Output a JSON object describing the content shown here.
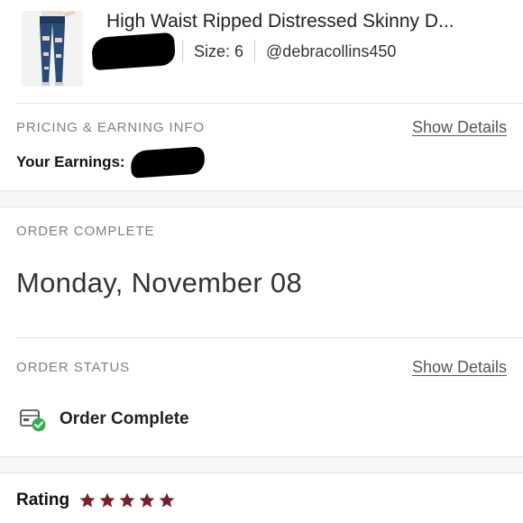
{
  "product": {
    "title": "High Waist Ripped Distressed Skinny D...",
    "size": "Size: 6",
    "seller": "@debracollins450"
  },
  "pricing": {
    "section_label": "PRICING & EARNING INFO",
    "show_details": "Show Details",
    "earnings_label": "Your Earnings:"
  },
  "order": {
    "section_label": "ORDER COMPLETE",
    "date": "Monday, November 08"
  },
  "status": {
    "section_label": "ORDER STATUS",
    "show_details": "Show Details",
    "status_text": "Order Complete",
    "icon": "package-check-icon"
  },
  "rating": {
    "label": "Rating",
    "stars": 5,
    "max_stars": 5,
    "star_color": "#7a1f2b"
  },
  "colors": {
    "check_green": "#2db34a",
    "link": "#555555",
    "section_label": "#7f7f7f"
  }
}
